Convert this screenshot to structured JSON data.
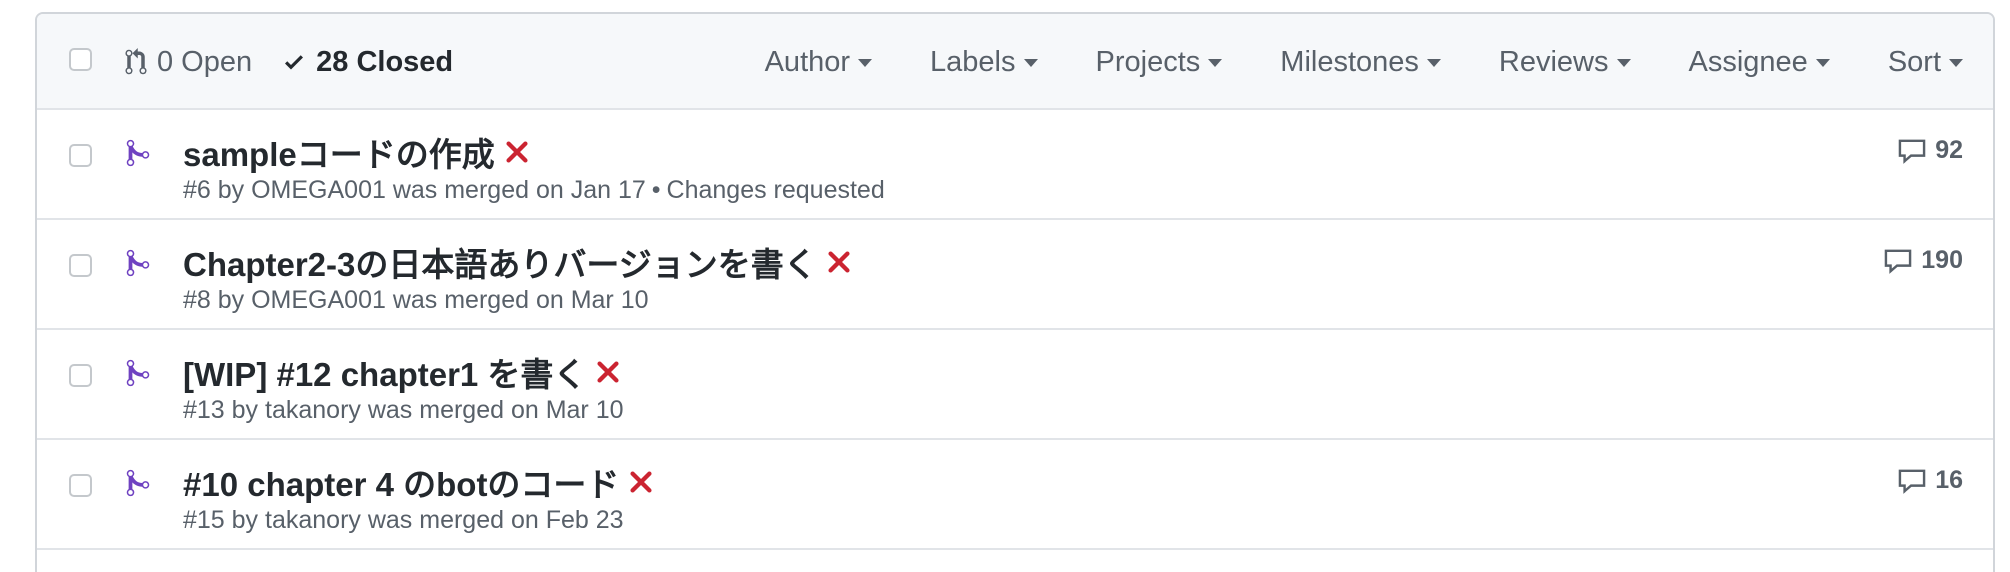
{
  "header": {
    "open_label": "0 Open",
    "closed_label": "28 Closed",
    "filters": [
      "Author",
      "Labels",
      "Projects",
      "Milestones",
      "Reviews",
      "Assignee",
      "Sort"
    ]
  },
  "pull_requests": [
    {
      "title": "sampleコードの作成",
      "meta": "#6 by OMEGA001 was merged on Jan 17",
      "review_status": "Changes requested",
      "comments": "92"
    },
    {
      "title": "Chapter2-3の日本語ありバージョンを書く",
      "meta": "#8 by OMEGA001 was merged on Mar 10",
      "review_status": "",
      "comments": "190"
    },
    {
      "title": "[WIP] #12 chapter1 を書く",
      "meta": "#13 by takanory was merged on Mar 10",
      "review_status": "",
      "comments": ""
    },
    {
      "title": "#10 chapter 4 のbotのコード",
      "meta": "#15 by takanory was merged on Feb 23",
      "review_status": "",
      "comments": "16"
    }
  ],
  "colors": {
    "merged_icon": "#6f42c1",
    "failure_x": "#cb2431",
    "text": "#24292e",
    "muted": "#586069"
  }
}
